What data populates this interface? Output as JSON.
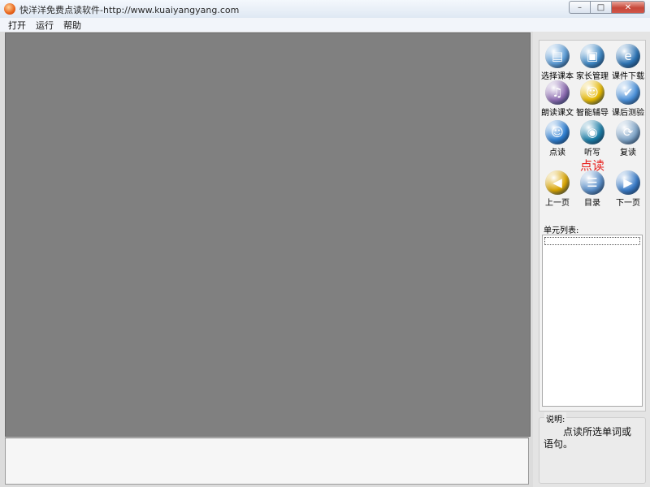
{
  "window": {
    "title": "快洋洋免费点读软件-http://www.kuaiyangyang.com",
    "buttons": {
      "minimize": "–",
      "maximize": "□",
      "close": "✕"
    }
  },
  "menu": [
    "打开",
    "运行",
    "帮助"
  ],
  "toolbar": {
    "tools": [
      {
        "label": "选择课本",
        "icon": "book-selection-icon",
        "glyph": "▤",
        "color": "#5b9bd5"
      },
      {
        "label": "家长管理",
        "icon": "folder-manage-icon",
        "glyph": "▣",
        "color": "#3f88c5"
      },
      {
        "label": "课件下载",
        "icon": "ie-download-icon",
        "glyph": "e",
        "color": "#2e75b6"
      },
      {
        "label": "朗读课文",
        "icon": "music-read-icon",
        "glyph": "♫",
        "color": "#8c6bb1"
      },
      {
        "label": "智能辅导",
        "icon": "smart-tutor-icon",
        "glyph": "☺",
        "color": "#e6b800"
      },
      {
        "label": "课后测验",
        "icon": "quiz-icon",
        "glyph": "✔",
        "color": "#4a90d9"
      },
      {
        "label": "点读",
        "icon": "point-read-icon",
        "glyph": "☺",
        "color": "#2f7fd1"
      },
      {
        "label": "听写",
        "icon": "dictation-globe-icon",
        "glyph": "◉",
        "color": "#1d7fa8"
      },
      {
        "label": "复读",
        "icon": "repeat-read-icon",
        "glyph": "⟳",
        "color": "#7fa4c7"
      },
      {
        "label": "上一页",
        "icon": "previous-page-icon",
        "glyph": "◀",
        "color": "#d9a400"
      },
      {
        "label": "目录",
        "icon": "contents-icon",
        "glyph": "☰",
        "color": "#5b8fc9"
      },
      {
        "label": "下一页",
        "icon": "next-page-icon",
        "glyph": "▶",
        "color": "#3a7cc8"
      }
    ],
    "mode": "点读"
  },
  "unit_list": {
    "label": "单元列表:",
    "items": [
      ""
    ]
  },
  "description": {
    "legend": "说明:",
    "text": "点读所选单词或语句。"
  }
}
